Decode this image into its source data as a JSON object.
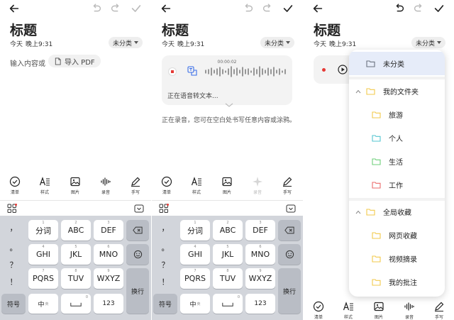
{
  "note": {
    "title": "标题",
    "date": "今天",
    "time": "晚上9:31",
    "category": "未分类",
    "placeholder": "输入内容或",
    "import_pdf_label": "导入 PDF"
  },
  "voice": {
    "elapsed": "00:00:02",
    "status": "正在语音转文本...",
    "recording_hint": "正在录音，您可在空白处书写任意内容或涂鸦。"
  },
  "toolbar": {
    "items": [
      {
        "label": "清单",
        "icon": "checkmark-circle-icon"
      },
      {
        "label": "样式",
        "icon": "text-style-icon"
      },
      {
        "label": "图片",
        "icon": "image-icon"
      },
      {
        "label": "录音",
        "icon": "audio-wave-icon"
      },
      {
        "label": "手写",
        "icon": "pen-icon"
      }
    ]
  },
  "keyboard": {
    "symbols": [
      "，",
      "。",
      "？",
      "！"
    ],
    "rows": [
      [
        {
          "num": "1",
          "label": "分词"
        },
        {
          "num": "2",
          "label": "ABC"
        },
        {
          "num": "3",
          "label": "DEF"
        }
      ],
      [
        {
          "num": "4",
          "label": "GHI"
        },
        {
          "num": "5",
          "label": "JKL"
        },
        {
          "num": "6",
          "label": "MNO"
        }
      ],
      [
        {
          "num": "7",
          "label": "PQRS"
        },
        {
          "num": "8",
          "label": "TUV"
        },
        {
          "num": "9",
          "label": "WXYZ"
        }
      ]
    ],
    "symbol_key": "符号",
    "chinese_key": "中",
    "chinese_sub": "英",
    "zero_sub": "0",
    "number_key": "123",
    "enter_key": "换行"
  },
  "dropdown": {
    "items": [
      {
        "label": "未分类",
        "type": "folder",
        "color": "#9aa3b0",
        "selected": true
      },
      {
        "label": "我的文件夹",
        "type": "group"
      },
      {
        "label": "旅游",
        "type": "folder",
        "color": "#f2c94c"
      },
      {
        "label": "个人",
        "type": "folder",
        "color": "#56c6d0"
      },
      {
        "label": "生活",
        "type": "folder",
        "color": "#6fcf7b"
      },
      {
        "label": "工作",
        "type": "folder",
        "color": "#eb6b6b"
      },
      {
        "label": "全局收藏",
        "type": "group"
      },
      {
        "label": "网页收藏",
        "type": "folder",
        "color": "#f2c94c"
      },
      {
        "label": "视频摘录",
        "type": "folder",
        "color": "#f2c94c"
      },
      {
        "label": "我的批注",
        "type": "folder",
        "color": "#f2c94c"
      }
    ]
  },
  "colors": {
    "accent": "#3a6ee8",
    "record_red": "#e53935",
    "keyboard_bg": "#d2d5db"
  }
}
